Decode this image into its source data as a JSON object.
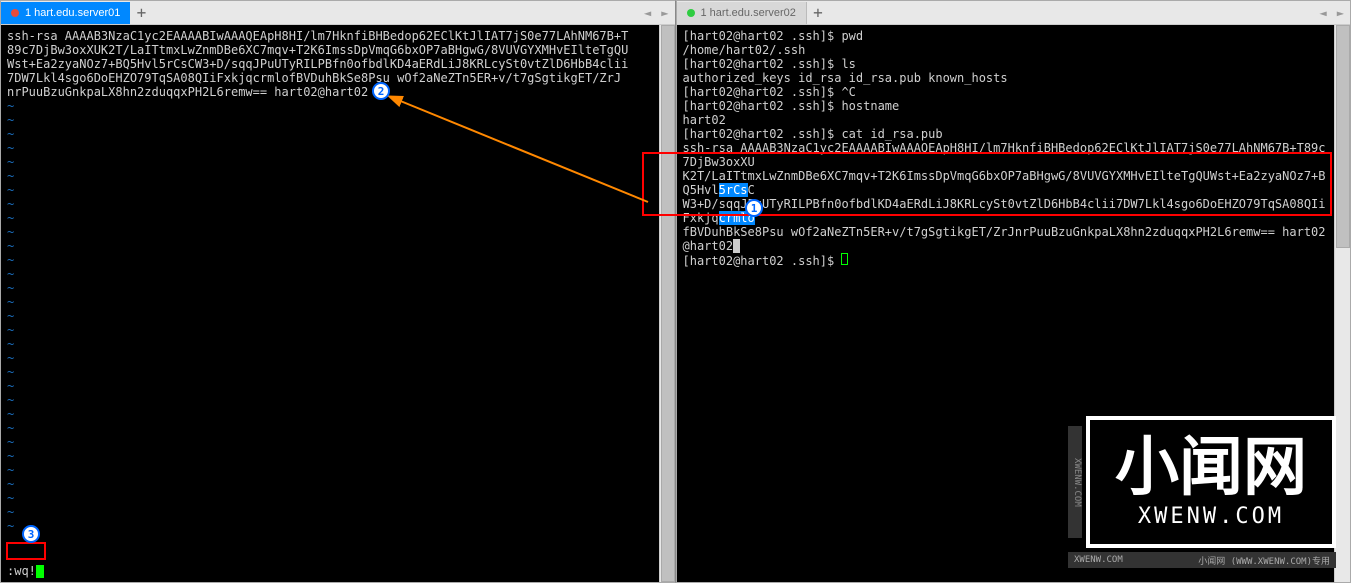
{
  "left": {
    "tab": {
      "label": "1 hart.edu.server01"
    },
    "content_lines": [
      "ssh-rsa AAAAB3NzaC1yc2EAAAABIwAAAQEApH8HI/lm7HknfiBHBedop62EClKtJlIAT7jS0e77LAhNM67B+T",
      "89c7DjBw3oxXUK2T/LaITtmxLwZnmDBe6XC7mqv+T2K6ImssDpVmqG6bxOP7aBHgwG/8VUVGYXMHvEIlteTgQU",
      "Wst+Ea2zyaNOz7+BQ5Hvl5rCsCW3+D/sqqJPuUTyRILPBfn0ofbdlKD4aERdLiJ8KRLcySt0vtZlD6HbB4clii",
      "7DW7Lkl4sgo6DoEHZO79TqSA08QIiFxkjqcrmlofBVDuhBkSe8Psu   wOf2aNeZTn5ER+v/t7gSgtikgET/ZrJ",
      "nrPuuBzuGnkpaLX8hn2zduqqxPH2L6remw== hart02@hart02"
    ],
    "cmdline": ":wq!"
  },
  "right": {
    "tab": {
      "label": "1 hart.edu.server02"
    },
    "prompt": "[hart02@hart02 .ssh]$",
    "lines": [
      {
        "prompt": true,
        "cmd": "pwd"
      },
      {
        "text": "/home/hart02/.ssh"
      },
      {
        "prompt": true,
        "cmd": "ls"
      },
      {
        "text": "authorized_keys  id_rsa  id_rsa.pub  known_hosts"
      },
      {
        "prompt": true,
        "cmd": "^C"
      },
      {
        "prompt": true,
        "cmd": "hostname"
      },
      {
        "text": "hart02"
      },
      {
        "prompt": true,
        "cmd": "cat id_rsa.pub"
      }
    ],
    "sshkey_lines": [
      "ssh-rsa AAAAB3NzaC1yc2EAAAABIwAAAQEApH8HI/lm7HknfiBHBedop62EClKtJlIAT7jS0e77LAhNM67B+T89c7DjBw3oxXU",
      "K2T/LaITtmxLwZnmDBe6XC7mqv+T2K6ImssDpVmqG6bxOP7aBHgwG/8VUVGYXMHvEIlteTgQUWst+Ea2zyaNOz7+BQ5Hvl",
      "W3+D/sqqJPuUTyRILPBfn0ofbdlKD4aERdLiJ8KRLcySt0vtZlD6HbB4clii7DW7Lkl4sgo6DoEHZO79TqSA08QIiFxkjq",
      "fBVDuhBkSe8Psu   wOf2aNeZTn5ER+v/t7gSgtikgET/ZrJnrPuuBzuGnkpaLX8hn2zduqqxPH2L6remw== hart02@hart02"
    ],
    "sshkey_hl": [
      "5rCs",
      "crmlo"
    ],
    "final_prompt": "[hart02@hart02 .ssh]$"
  },
  "watermark": {
    "text": "小闻网",
    "url": "XWENW.COM",
    "side": "XWENW.COM",
    "footer_left": "XWENW.COM",
    "footer_right": "小闻网 (WWW.XWENW.COM)专用"
  },
  "callouts": {
    "c1": "1",
    "c2": "2",
    "c3": "3"
  }
}
